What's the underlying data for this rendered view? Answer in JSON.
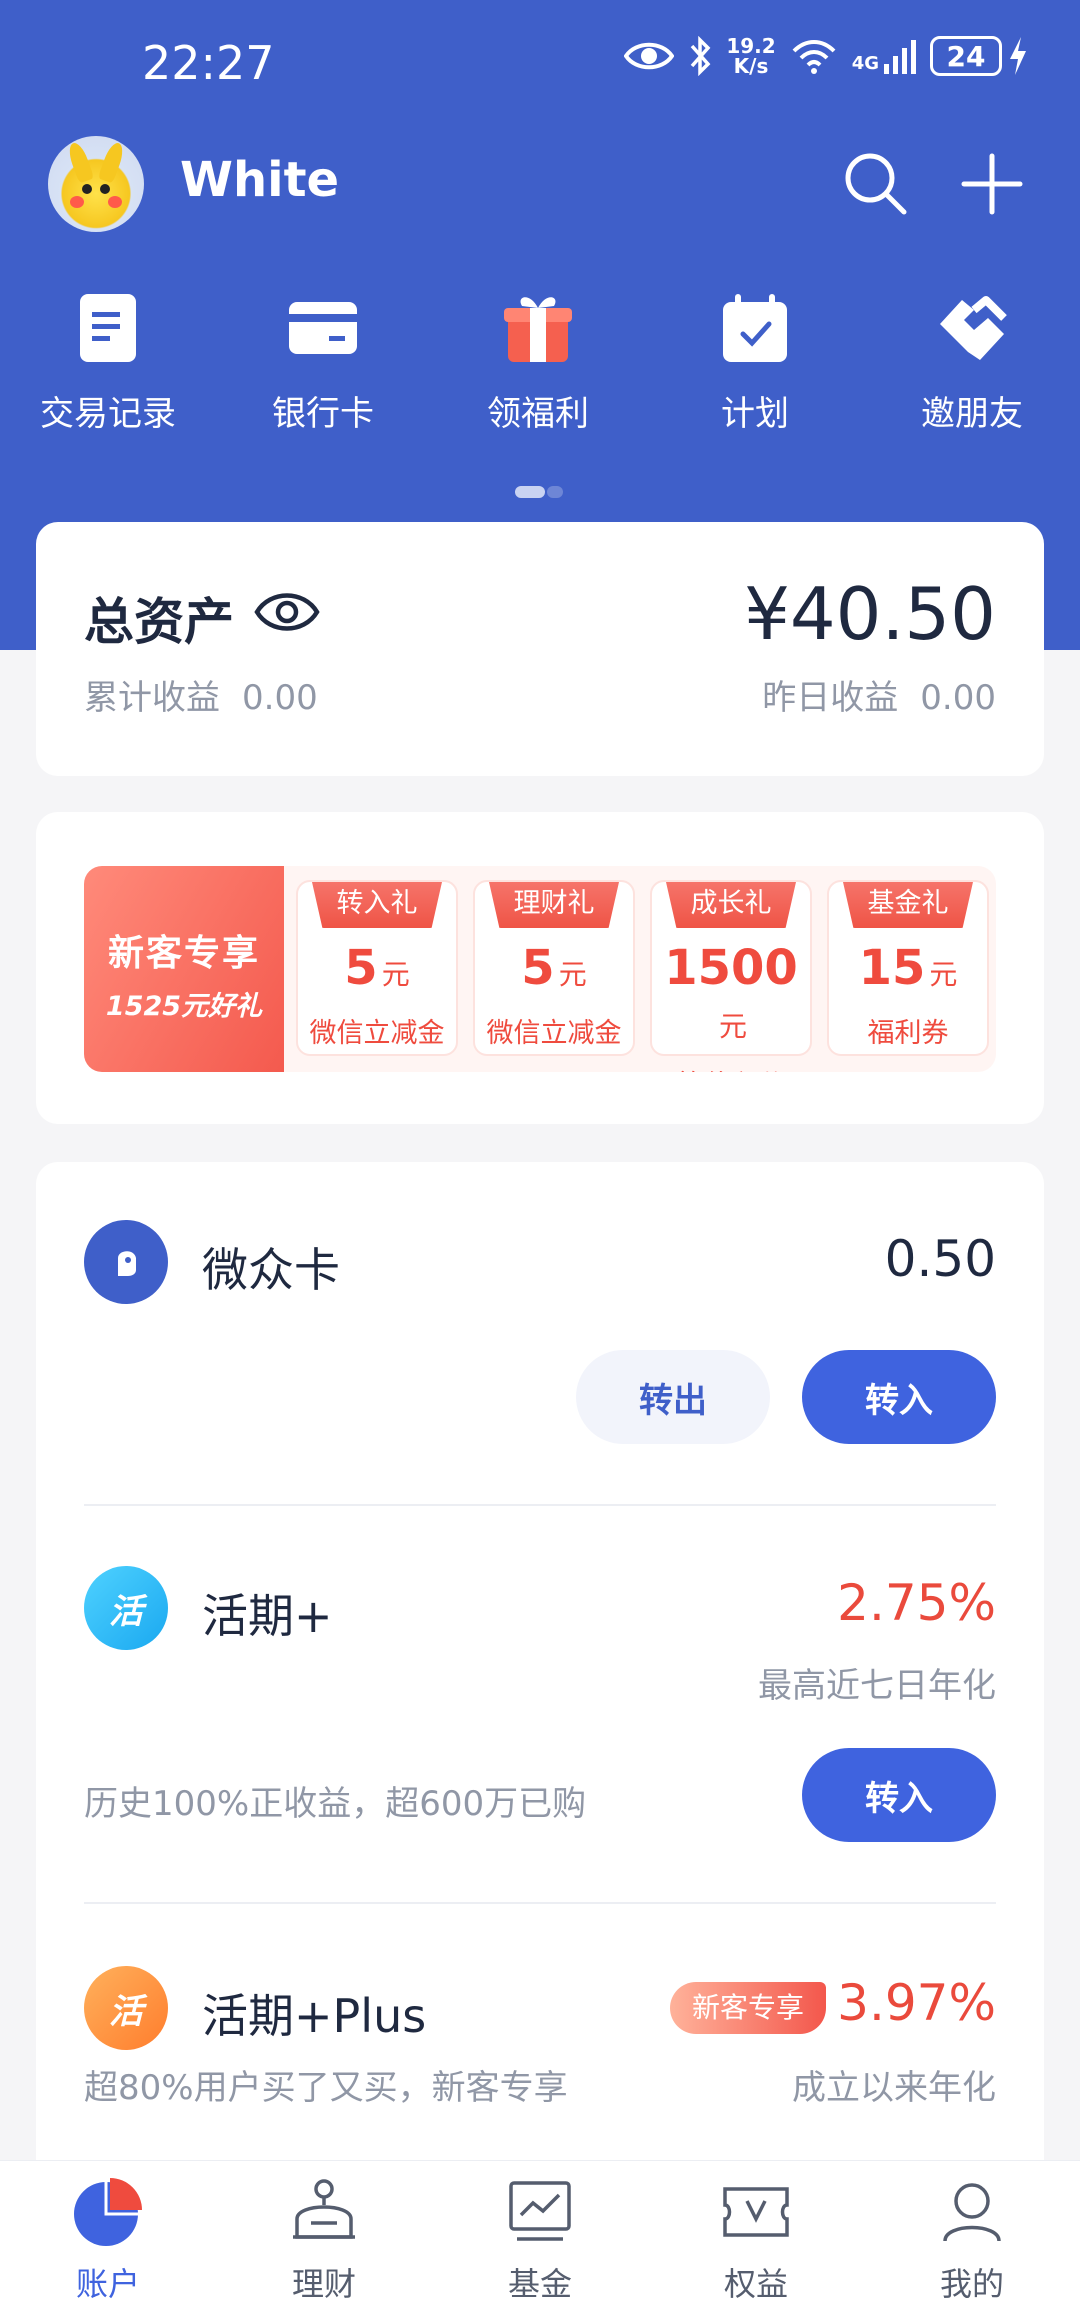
{
  "status_bar": {
    "time": "22:27",
    "net_speed_value": "19.2",
    "net_speed_unit": "K/s",
    "network": "4G",
    "battery": "24"
  },
  "header": {
    "username": "White",
    "search_icon": "search-icon",
    "add_icon": "plus-icon"
  },
  "quick_actions": [
    {
      "label": "交易记录",
      "icon": "document-icon"
    },
    {
      "label": "银行卡",
      "icon": "bank-card-icon"
    },
    {
      "label": "领福利",
      "icon": "gift-icon"
    },
    {
      "label": "计划",
      "icon": "calendar-check-icon"
    },
    {
      "label": "邀朋友",
      "icon": "handshake-icon"
    }
  ],
  "assets": {
    "title": "总资产",
    "amount": "¥40.50",
    "cumulative_label": "累计收益",
    "cumulative_value": "0.00",
    "yesterday_label": "昨日收益",
    "yesterday_value": "0.00"
  },
  "promo": {
    "title": "新客专享",
    "subtitle": "1525元好礼",
    "gifts": [
      {
        "tag": "转入礼",
        "amount": "5",
        "unit": "元",
        "desc": "微信立减金"
      },
      {
        "tag": "理财礼",
        "amount": "5",
        "unit": "元",
        "desc": "微信立减金"
      },
      {
        "tag": "成长礼",
        "amount": "1500",
        "unit": "元",
        "desc": "等价积分"
      },
      {
        "tag": "基金礼",
        "amount": "15",
        "unit": "元",
        "desc": "福利券"
      }
    ]
  },
  "accounts": {
    "weizhong": {
      "name": "微众卡",
      "value": "0.50",
      "withdraw_label": "转出",
      "deposit_label": "转入"
    },
    "huoqi": {
      "icon_text": "活",
      "name": "活期+",
      "rate": "2.75%",
      "rate_desc": "最高近七日年化",
      "note": "历史100%正收益，超600万已购",
      "deposit_label": "转入"
    },
    "huoqi_plus": {
      "icon_text": "活",
      "name": "活期+Plus",
      "badge": "新客专享",
      "rate": "3.97%",
      "rate_desc": "成立以来年化",
      "note": "超80%用户买了又买，新客专享"
    }
  },
  "bottom_nav": [
    {
      "label": "账户",
      "icon": "pie-chart-icon",
      "active": true
    },
    {
      "label": "理财",
      "icon": "piggy-bank-icon",
      "active": false
    },
    {
      "label": "基金",
      "icon": "trend-chart-icon",
      "active": false
    },
    {
      "label": "权益",
      "icon": "voucher-icon",
      "active": false
    },
    {
      "label": "我的",
      "icon": "user-icon",
      "active": false
    }
  ],
  "colors": {
    "brand": "#3f5fc9",
    "button": "#3f63df",
    "red": "#ea4a3c"
  }
}
